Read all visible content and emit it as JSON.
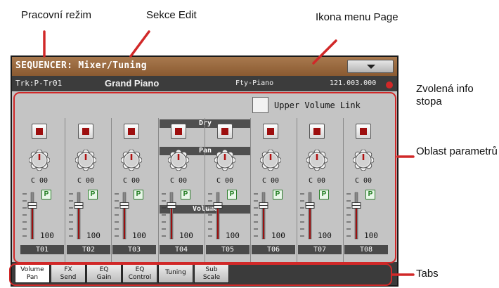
{
  "annotations": {
    "operating_mode": "Pracovní režim",
    "edit_section": "Sekce Edit",
    "page_menu_icon": "Ikona menu Page",
    "selected_track_info": "Zvolená info stopa",
    "parameter_area": "Oblast parametrů",
    "tabs": "Tabs"
  },
  "header": {
    "title": "SEQUENCER: Mixer/Tuning",
    "page_menu_icon": "triangle-down-icon"
  },
  "info": {
    "track": "Trk:P-Tr01",
    "sound": "Grand Piano",
    "bank": "Fty-Piano",
    "position": "121.003.000"
  },
  "upper_volume_link": {
    "label": "Upper Volume Link",
    "checked": false
  },
  "groups": {
    "dry": "Dry",
    "pan": "Pan",
    "volume": "Volume"
  },
  "tracks": [
    {
      "label": "T01",
      "pan": "C 00",
      "volume": "100",
      "muted_led_on": true
    },
    {
      "label": "T02",
      "pan": "C 00",
      "volume": "100",
      "muted_led_on": true
    },
    {
      "label": "T03",
      "pan": "C 00",
      "volume": "100",
      "muted_led_on": true
    },
    {
      "label": "T04",
      "pan": "C 00",
      "volume": "100",
      "muted_led_on": true
    },
    {
      "label": "T05",
      "pan": "C 00",
      "volume": "100",
      "muted_led_on": true
    },
    {
      "label": "T06",
      "pan": "C 00",
      "volume": "100",
      "muted_led_on": true
    },
    {
      "label": "T07",
      "pan": "C 00",
      "volume": "100",
      "muted_led_on": true
    },
    {
      "label": "T08",
      "pan": "C 00",
      "volume": "100",
      "muted_led_on": true
    }
  ],
  "play_button": "P",
  "tabs": [
    {
      "label": "Volume\nPan",
      "active": true
    },
    {
      "label": "FX\nSend",
      "active": false
    },
    {
      "label": "EQ\nGain",
      "active": false
    },
    {
      "label": "EQ\nControl",
      "active": false
    },
    {
      "label": "Tuning",
      "active": false
    },
    {
      "label": "Sub\nScale",
      "active": false
    }
  ],
  "colors": {
    "title_bar": "#8a5a31",
    "callout_red": "#d12828",
    "mute_led": "#9d0e0e",
    "play_green": "#1c7a1c"
  }
}
